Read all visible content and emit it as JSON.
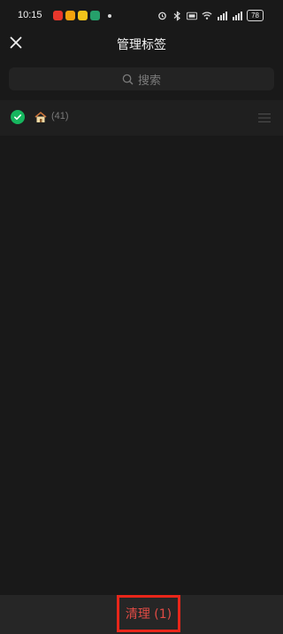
{
  "status": {
    "time": "10:15",
    "battery": "78"
  },
  "header": {
    "title": "管理标签"
  },
  "search": {
    "placeholder": "搜索"
  },
  "tags": [
    {
      "emoji": "🏠",
      "count": "(41)",
      "selected": true
    }
  ],
  "footer": {
    "clean_label": "清理 (1)"
  },
  "colors": {
    "background": "#191919",
    "accent_green": "#16b65e",
    "danger_red": "#e24b45"
  }
}
